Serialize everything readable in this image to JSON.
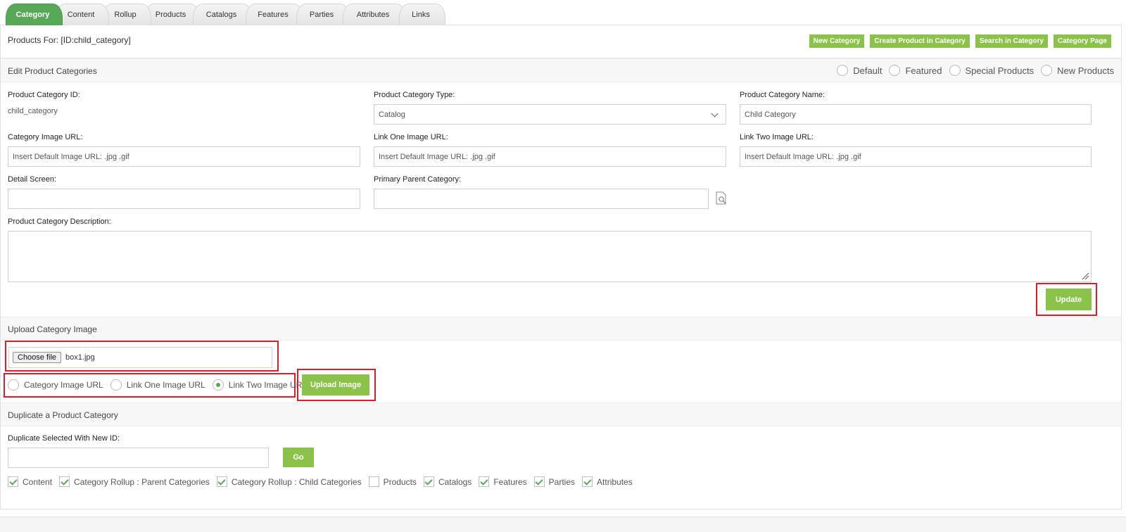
{
  "tabs": [
    "Category",
    "Content",
    "Rollup",
    "Products",
    "Catalogs",
    "Features",
    "Parties",
    "Attributes",
    "Links"
  ],
  "header": {
    "title": "Products For: [ID:child_category]",
    "buttons": [
      "New Category",
      "Create Product in Category",
      "Search in Category",
      "Category Page"
    ]
  },
  "edit": {
    "title": "Edit Product Categories",
    "radios": [
      "Default",
      "Featured",
      "Special Products",
      "New Products"
    ],
    "id_label": "Product Category ID:",
    "id_value": "child_category",
    "type_label": "Product Category Type:",
    "type_value": "Catalog",
    "name_label": "Product Category Name:",
    "name_value": "Child Category",
    "image_url_label": "Category Image URL:",
    "image_url_placeholder": "Insert Default Image URL: .jpg .gif",
    "link_one_label": "Link One Image URL:",
    "link_one_placeholder": "Insert Default Image URL: .jpg .gif",
    "link_two_label": "Link Two Image URL:",
    "link_two_placeholder": "Insert Default Image URL: .jpg .gif",
    "detail_label": "Detail Screen:",
    "parent_label": "Primary Parent Category:",
    "desc_label": "Product Category Description:",
    "update": "Update"
  },
  "upload": {
    "title": "Upload Category Image",
    "choose": "Choose file",
    "file_name": "box1.jpg",
    "radios": [
      "Category Image URL",
      "Link One Image URL",
      "Link Two Image URL"
    ],
    "selected": "Link Two Image URL",
    "button": "Upload Image"
  },
  "duplicate": {
    "title": "Duplicate a Product Category",
    "label": "Duplicate Selected With New ID:",
    "go": "Go",
    "checks": [
      {
        "label": "Content",
        "checked": true
      },
      {
        "label": "Category Rollup : Parent Categories",
        "checked": true
      },
      {
        "label": "Category Rollup : Child Categories",
        "checked": true
      },
      {
        "label": "Products",
        "checked": false
      },
      {
        "label": "Catalogs",
        "checked": true
      },
      {
        "label": "Features",
        "checked": true
      },
      {
        "label": "Parties",
        "checked": true
      },
      {
        "label": "Attributes",
        "checked": true
      }
    ]
  },
  "colors": {
    "accent": "#8bc34a",
    "tab_active": "#58a957",
    "highlight": "#d9202a"
  }
}
